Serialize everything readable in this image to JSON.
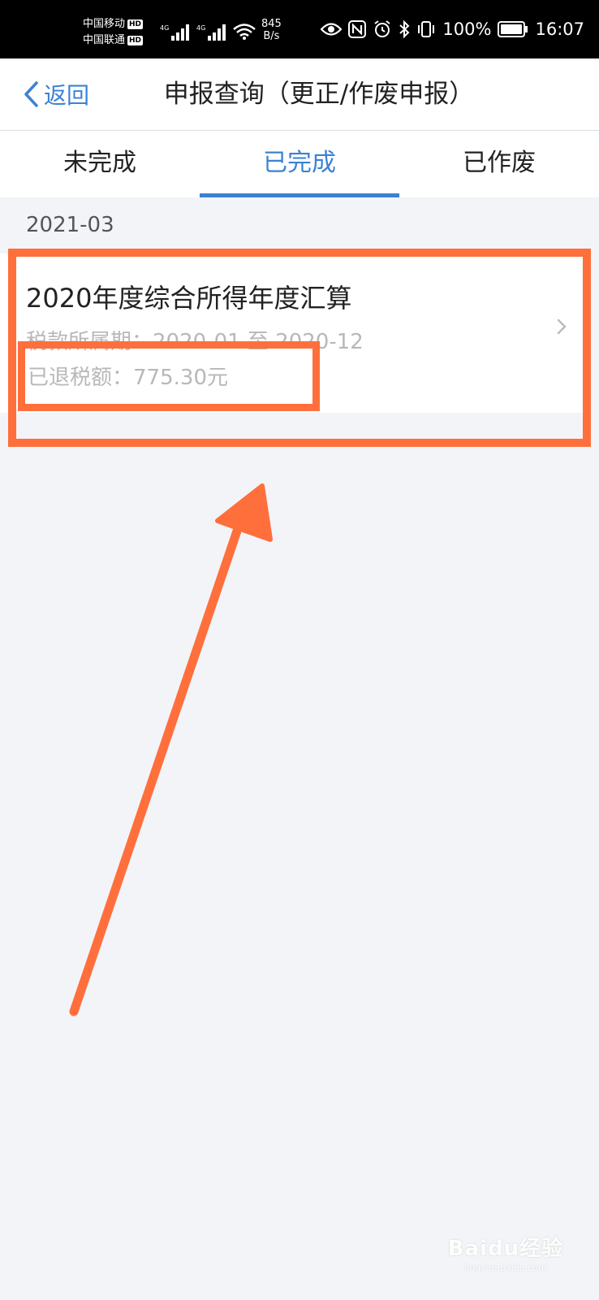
{
  "status_bar": {
    "carrier_1": "中国移动",
    "carrier_2": "中国联通",
    "hd_badge": "HD",
    "network_1": "4G",
    "network_2": "4G",
    "speed_value": "845",
    "speed_unit": "B/s",
    "battery_percent": "100%",
    "time": "16:07",
    "icons": [
      "eye-icon",
      "nfc-icon",
      "alarm-icon",
      "bluetooth-icon",
      "vibrate-icon",
      "battery-icon"
    ]
  },
  "header": {
    "back_label": "返回",
    "title": "申报查询（更正/作废申报）"
  },
  "tabs": [
    {
      "label": "未完成",
      "active": false
    },
    {
      "label": "已完成",
      "active": true
    },
    {
      "label": "已作废",
      "active": false
    }
  ],
  "records": {
    "group_date": "2021-03",
    "item": {
      "title": "2020年度综合所得年度汇算",
      "period_label": "税款所属期：",
      "period_value": "2020-01 至 2020-12",
      "refund_label": "已退税额：",
      "refund_value": "775.30元"
    }
  },
  "watermark": {
    "logo": "Baidu经验",
    "sub": "jingyan.baidu.com"
  },
  "colors": {
    "accent": "#3b82d4",
    "annotation": "#ff6f3c",
    "background": "#f3f4f8"
  }
}
